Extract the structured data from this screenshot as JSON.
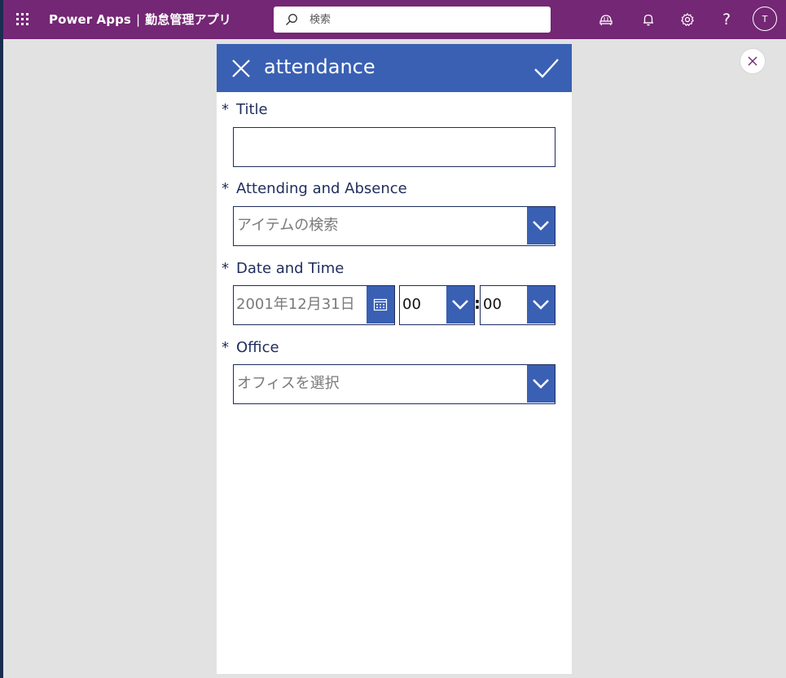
{
  "topbar": {
    "app_name": "Power Apps",
    "separator": "|",
    "app_title": "勤怠管理アプリ",
    "search_placeholder": "検索",
    "help_label": "?",
    "avatar_initial": "T",
    "background_color": "#742774"
  },
  "form": {
    "header_title": "attendance",
    "header_color": "#3a60b4",
    "required_marker": "*",
    "fields": {
      "title": {
        "label": "Title",
        "value": ""
      },
      "attendance": {
        "label": "Attending and Absence",
        "placeholder": "アイテムの検索"
      },
      "datetime": {
        "label": "Date and Time",
        "date_value": "2001年12月31日",
        "hour": "00",
        "minute": "00",
        "time_separator": ":"
      },
      "office": {
        "label": "Office",
        "placeholder": "オフィスを選択"
      }
    }
  },
  "icons": [
    "waffle-icon",
    "search-icon",
    "remote-assist-icon",
    "bell-icon",
    "gear-icon",
    "help-icon",
    "close-icon",
    "check-icon",
    "calendar-icon",
    "chevron-down-icon"
  ]
}
